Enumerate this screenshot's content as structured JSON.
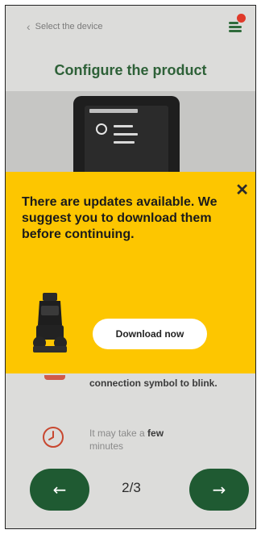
{
  "header": {
    "back_label": "Select the device",
    "menu_icon": "menu-icon",
    "notification_count": ""
  },
  "page": {
    "title": "Configure the product"
  },
  "modal": {
    "message": "There are updates available. We suggest you to download them before continuing.",
    "download_label": "Download now",
    "background_color": "#fdc600"
  },
  "steps": {
    "step1_text": "connection symbol to blink.",
    "step2_text_prefix": "It may take a ",
    "step2_text_bold": "few",
    "step2_text_suffix": "minutes"
  },
  "footer": {
    "page_indicator": "2/3",
    "prev_icon": "arrow-left-icon",
    "next_icon": "arrow-right-icon",
    "accent_color": "#1f5a32"
  }
}
